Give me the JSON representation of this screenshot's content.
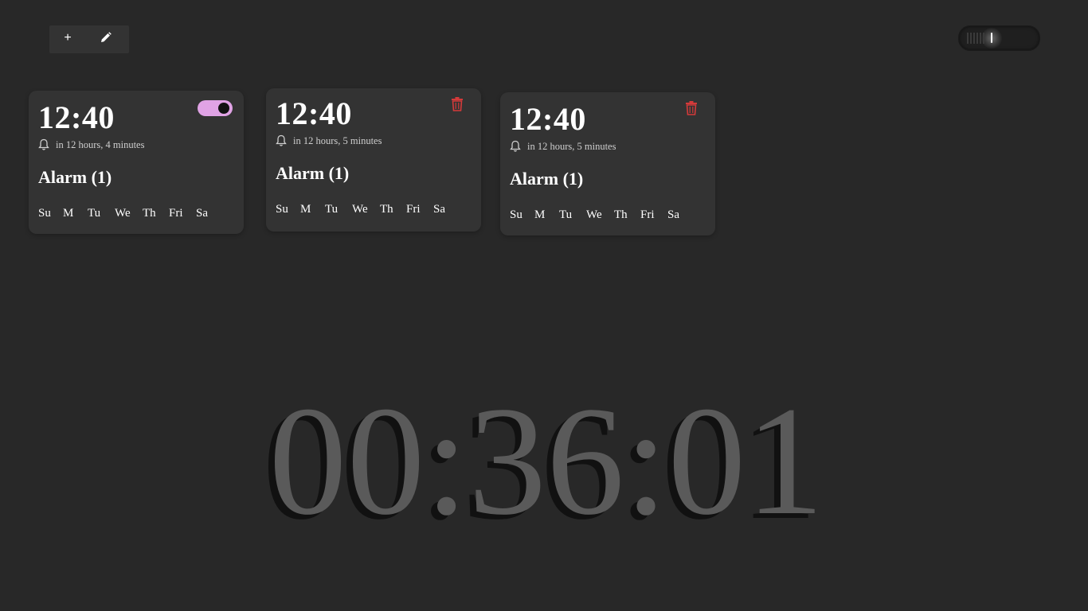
{
  "toolbar": {
    "add_label": "+",
    "edit_icon": "pencil-icon"
  },
  "theme_toggle": {
    "icon": "moon-icon"
  },
  "colors": {
    "background": "#282828",
    "card": "#333333",
    "toggle_on": "#e0a3e5",
    "trash": "#d43a3a",
    "clock": "#5a5a5a"
  },
  "alarms": [
    {
      "time": "12:40",
      "until": "in 12 hours, 4 minutes",
      "name": "Alarm (1)",
      "days": [
        "Su",
        "M",
        "Tu",
        "We",
        "Th",
        "Fri",
        "Sa"
      ],
      "control": "toggle-on"
    },
    {
      "time": "12:40",
      "until": "in 12 hours, 5 minutes",
      "name": "Alarm (1)",
      "days": [
        "Su",
        "M",
        "Tu",
        "We",
        "Th",
        "Fri",
        "Sa"
      ],
      "control": "trash-icon"
    },
    {
      "time": "12:40",
      "until": "in 12 hours, 5 minutes",
      "name": "Alarm (1)",
      "days": [
        "Su",
        "M",
        "Tu",
        "We",
        "Th",
        "Fri",
        "Sa"
      ],
      "control": "trash-icon"
    }
  ],
  "clock": {
    "time": "00:36:01"
  }
}
